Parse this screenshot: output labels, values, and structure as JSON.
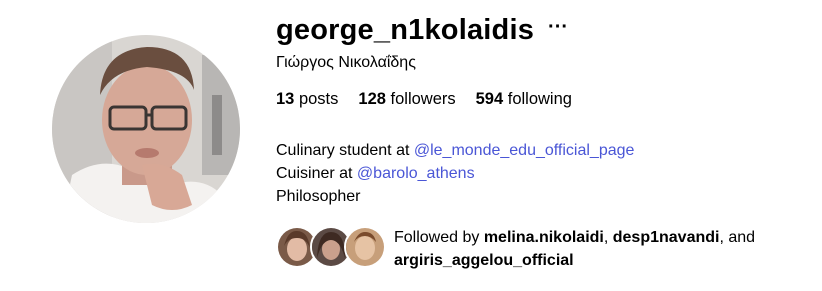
{
  "profile": {
    "username": "george_n1kolaidis",
    "more_label": "···",
    "full_name": "Γιώργος Νικολαΐδης",
    "stats": {
      "posts_count": "13",
      "posts_label": "posts",
      "followers_count": "128",
      "followers_label": "followers",
      "following_count": "594",
      "following_label": "following"
    },
    "bio": {
      "line1_prefix": "Culinary student at ",
      "line1_mention": "@le_monde_edu_official_page",
      "line2_prefix": "Cuisiner at ",
      "line2_mention": "@barolo_athens",
      "line3": "Philosopher"
    },
    "followed_by": {
      "prefix": "Followed by ",
      "user1": "melina.nikolaidi",
      "sep1": ", ",
      "user2": "desp1navandi",
      "sep2": ", and ",
      "user3": "argiris_aggelou_official"
    }
  },
  "colors": {
    "link": "#4a56d6",
    "text": "#000000",
    "background": "#ffffff"
  }
}
